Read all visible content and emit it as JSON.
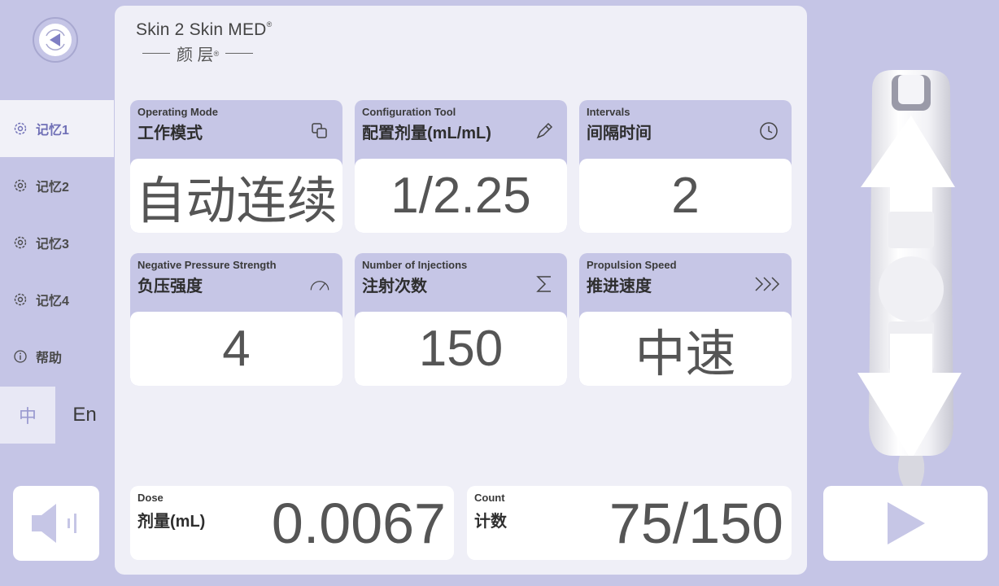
{
  "sidebar": {
    "items": [
      {
        "label": "记忆1",
        "icon": "gear-icon",
        "active": true
      },
      {
        "label": "记忆2",
        "icon": "gear-icon",
        "active": false
      },
      {
        "label": "记忆3",
        "icon": "gear-icon",
        "active": false
      },
      {
        "label": "记忆4",
        "icon": "gear-icon",
        "active": false
      },
      {
        "label": "帮助",
        "icon": "info-icon",
        "active": false
      }
    ],
    "language": {
      "zh": "中",
      "en": "En",
      "selected": "zh"
    }
  },
  "logo": {
    "brand": "Skin 2 Skin MED",
    "registered": "®",
    "sub": "颜 层",
    "sub_reg": "®"
  },
  "cards": [
    {
      "en": "Operating Mode",
      "zh": "工作模式",
      "value": "自动连续",
      "icon": "copy-icon"
    },
    {
      "en": "Configuration Tool",
      "zh": "配置剂量(mL/mL)",
      "value": "1/2.25",
      "icon": "pen-icon"
    },
    {
      "en": "Intervals",
      "zh": "间隔时间",
      "value": "2",
      "icon": "clock-icon"
    },
    {
      "en": "Negative Pressure Strength",
      "zh": "负压强度",
      "value": "4",
      "icon": "gauge-icon"
    },
    {
      "en": "Number of Injections",
      "zh": "注射次数",
      "value": "150",
      "icon": "sigma-icon"
    },
    {
      "en": "Propulsion Speed",
      "zh": "推进速度",
      "value": "中速",
      "icon": "chevrons-right-icon"
    }
  ],
  "dose": {
    "en": "Dose",
    "zh": "剂量(mL)",
    "value": "0.0067"
  },
  "count": {
    "en": "Count",
    "zh": "计数",
    "value": "75/150"
  },
  "colors": {
    "background": "#c5c5e6",
    "panel": "#efeff7",
    "card_header": "#c6c6e6",
    "accent": "#6f6fb6"
  }
}
